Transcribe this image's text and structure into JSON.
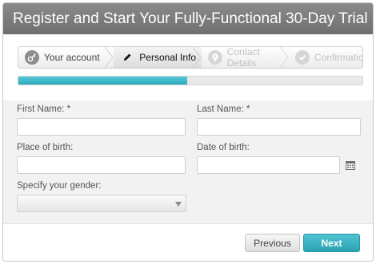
{
  "header": {
    "title": "Register and Start Your Fully-Functional 30-Day Trial"
  },
  "wizard": {
    "steps": [
      {
        "label": "Your account",
        "icon": "key-icon",
        "state": "completed"
      },
      {
        "label": "Personal Info",
        "icon": "pencil-icon",
        "state": "active"
      },
      {
        "label": "Contact Details",
        "icon": "location-pin-icon",
        "state": "disabled"
      },
      {
        "label": "Confirmation",
        "icon": "checkmark-icon",
        "state": "disabled"
      }
    ],
    "progress": 0.49
  },
  "form": {
    "first_name": {
      "label": "First Name: *",
      "value": "",
      "placeholder": ""
    },
    "last_name": {
      "label": "Last Name: *",
      "value": "",
      "placeholder": ""
    },
    "place_of_birth": {
      "label": "Place of birth:",
      "value": "",
      "placeholder": ""
    },
    "date_of_birth": {
      "label": "Date of birth:",
      "value": "",
      "placeholder": "",
      "icon": "calendar-icon"
    },
    "gender": {
      "label": "Specify your gender:",
      "selected": ""
    }
  },
  "footer": {
    "previous_label": "Previous",
    "next_label": "Next"
  },
  "colors": {
    "accent": "#2ea9b8",
    "header": "#7a7a7a"
  }
}
